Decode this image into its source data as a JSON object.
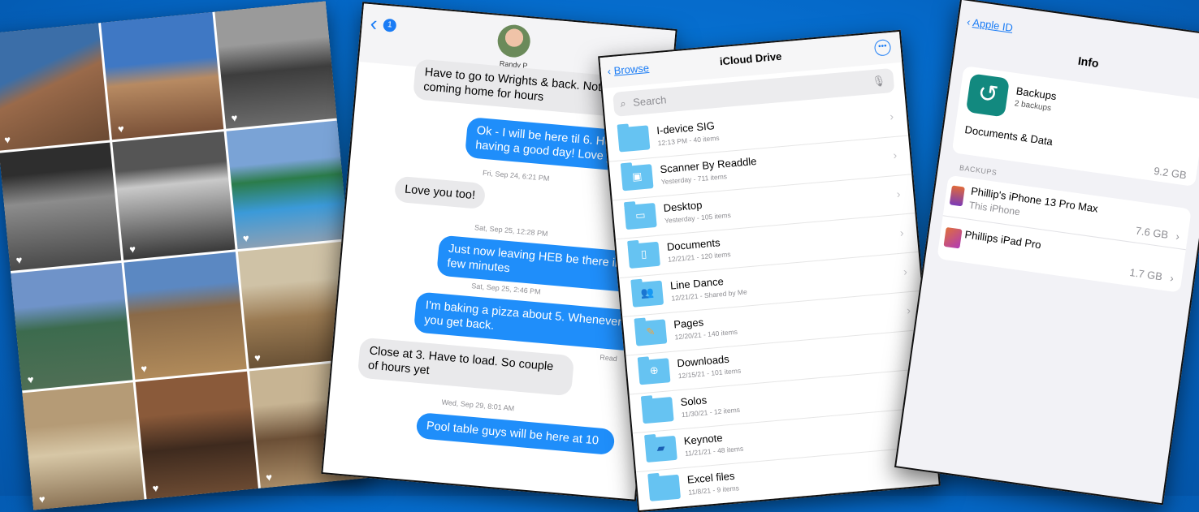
{
  "messages": {
    "back_badge": "1",
    "contact_name": "Randy P",
    "items": [
      {
        "type": "in",
        "text": "Have to go to Wrights & back. Not coming home for hours"
      },
      {
        "type": "out",
        "text": "Ok - I will be here til 6. Hope you having a good day! Love you..."
      },
      {
        "type": "time",
        "text": "Fri, Sep 24, 6:21 PM"
      },
      {
        "type": "in",
        "text": "Love you too!"
      },
      {
        "type": "time",
        "text": "Sat, Sep 25, 12:28 PM"
      },
      {
        "type": "out",
        "text": "Just now leaving HEB be there in a few minutes"
      },
      {
        "type": "time",
        "text": "Sat, Sep 25, 2:46 PM"
      },
      {
        "type": "out",
        "text": "I'm baking a pizza about 5. Whenever you get back."
      },
      {
        "type": "read",
        "text": "Read"
      },
      {
        "type": "in",
        "text": "Close at 3. Have to load. So couple of hours yet"
      },
      {
        "type": "time",
        "text": "Wed, Sep 29, 8:01 AM"
      },
      {
        "type": "out",
        "text": "Pool table guys will be here at 10"
      }
    ]
  },
  "files": {
    "back_label": "Browse",
    "title": "iCloud Drive",
    "search_placeholder": "Search",
    "items": [
      {
        "name": "I-device SIG",
        "meta": "12:13 PM - 40 items",
        "icon": "folder"
      },
      {
        "name": "Scanner By Readdle",
        "meta": "Yesterday - 711 items",
        "icon": "app-folder"
      },
      {
        "name": "Desktop",
        "meta": "Yesterday - 105 items",
        "icon": "desktop-folder"
      },
      {
        "name": "Documents",
        "meta": "12/21/21 - 120 items",
        "icon": "document-folder"
      },
      {
        "name": "Line Dance",
        "meta": "12/21/21 - Shared by Me",
        "icon": "shared-folder"
      },
      {
        "name": "Pages",
        "meta": "12/20/21 - 140 items",
        "icon": "pages-folder"
      },
      {
        "name": "Downloads",
        "meta": "12/15/21 - 101 items",
        "icon": "download-folder"
      },
      {
        "name": "Solos",
        "meta": "11/30/21 - 12 items",
        "icon": "folder"
      },
      {
        "name": "Keynote",
        "meta": "11/21/21 - 48 items",
        "icon": "keynote-folder"
      },
      {
        "name": "Excel files",
        "meta": "11/8/21 - 9 items",
        "icon": "folder"
      }
    ]
  },
  "settings": {
    "back_label": "Apple ID",
    "title": "Info",
    "app_name": "Backups",
    "app_sub": "2 backups",
    "docs_label": "Documents & Data",
    "docs_size": "9.2 GB",
    "section_header": "BACKUPS",
    "devices": [
      {
        "name": "Phillip's iPhone 13 Pro Max",
        "sub": "This iPhone",
        "size": "7.6 GB"
      },
      {
        "name": "Phillips iPad Pro",
        "sub": "",
        "size": "1.7 GB"
      }
    ]
  },
  "colors": {
    "background": "#0569c9",
    "accent": "#1a7cf5",
    "bubble_out": "#1f8efa",
    "folder": "#66c3f2",
    "backups_icon": "#12897f"
  }
}
